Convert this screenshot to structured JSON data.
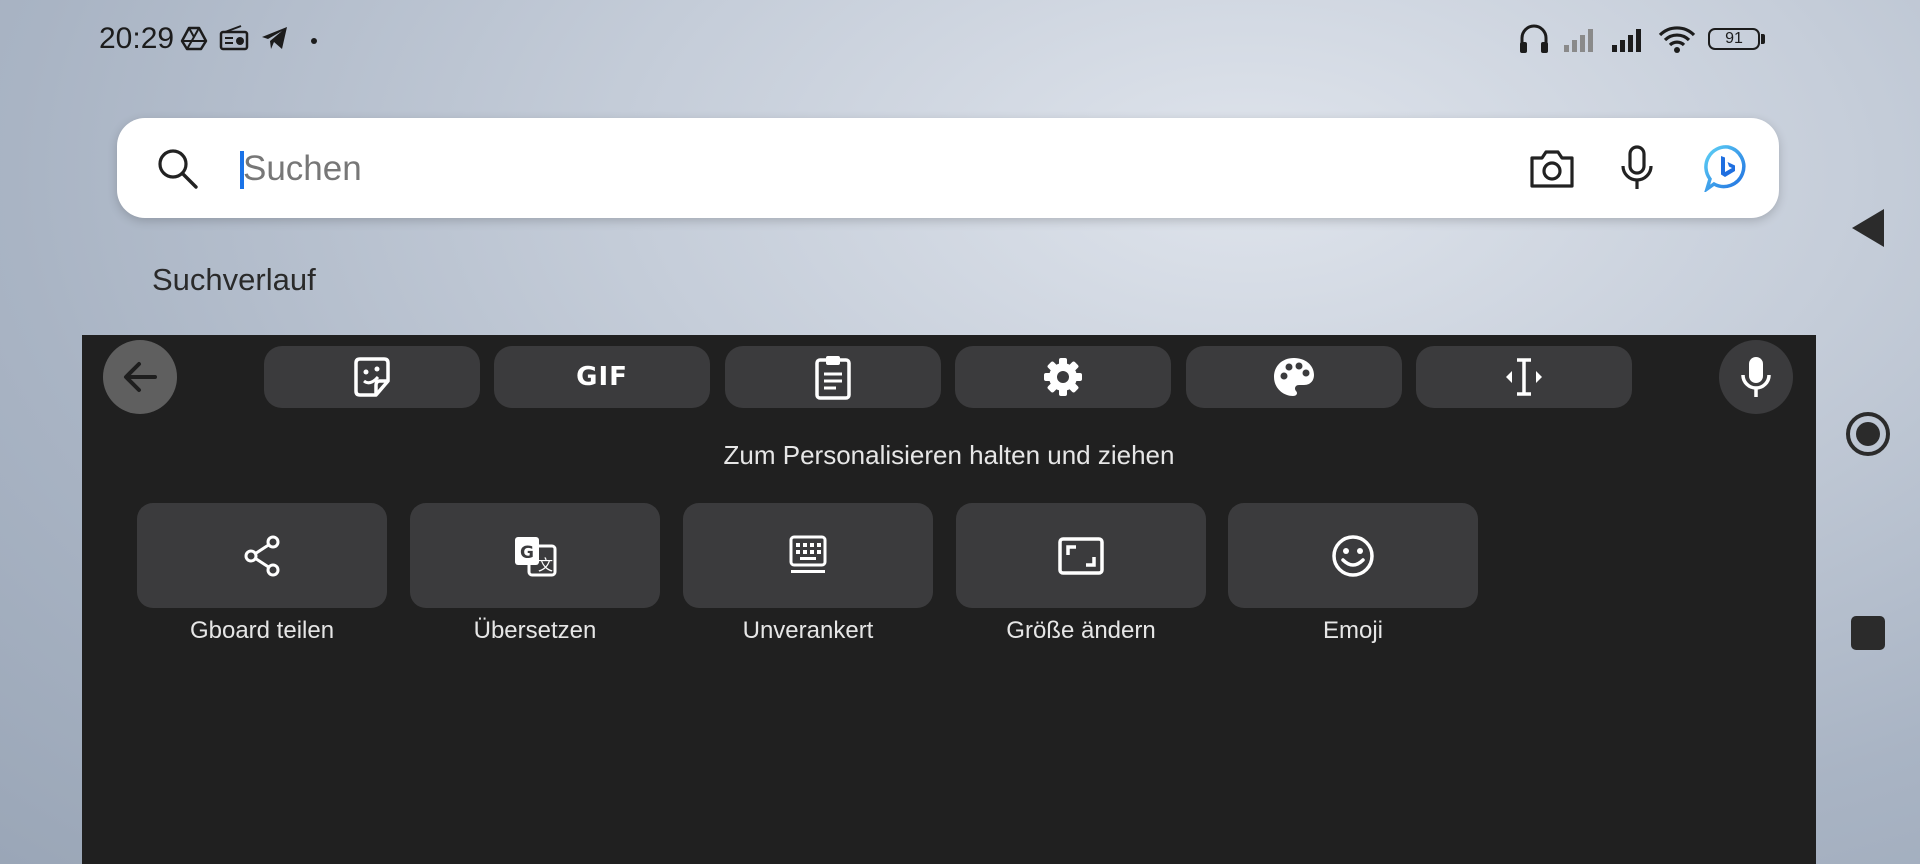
{
  "status_bar": {
    "time": "20:29",
    "battery_level": "91",
    "icons": [
      "drive-icon",
      "radio-icon",
      "telegram-icon",
      "dot-icon",
      "headphones-icon",
      "signal-weak-icon",
      "signal-icon",
      "wifi-icon",
      "battery-icon"
    ]
  },
  "search": {
    "placeholder": "Suchen",
    "value": "",
    "actions": [
      "camera-icon",
      "microphone-icon",
      "bing-chat-icon"
    ]
  },
  "history": {
    "label": "Suchverlauf"
  },
  "keyboard": {
    "toolbar": [
      "sticker-icon",
      "gif-icon",
      "clipboard-icon",
      "settings-icon",
      "palette-icon",
      "text-cursor-icon"
    ],
    "gif_label": "GIF",
    "hint": "Zum Personalisieren halten und ziehen",
    "tiles": [
      {
        "label": "Gboard teilen",
        "icon": "share-icon"
      },
      {
        "label": "Übersetzen",
        "icon": "translate-icon"
      },
      {
        "label": "Unverankert",
        "icon": "floating-keyboard-icon"
      },
      {
        "label": "Größe ändern",
        "icon": "resize-icon"
      },
      {
        "label": "Emoji",
        "icon": "emoji-icon"
      }
    ]
  },
  "nav": [
    "nav-back-icon",
    "nav-home-icon",
    "nav-recents-icon"
  ],
  "colors": {
    "keyboard_bg": "#202020",
    "key_bg": "#3b3b3d",
    "cursor": "#1a73e8"
  }
}
